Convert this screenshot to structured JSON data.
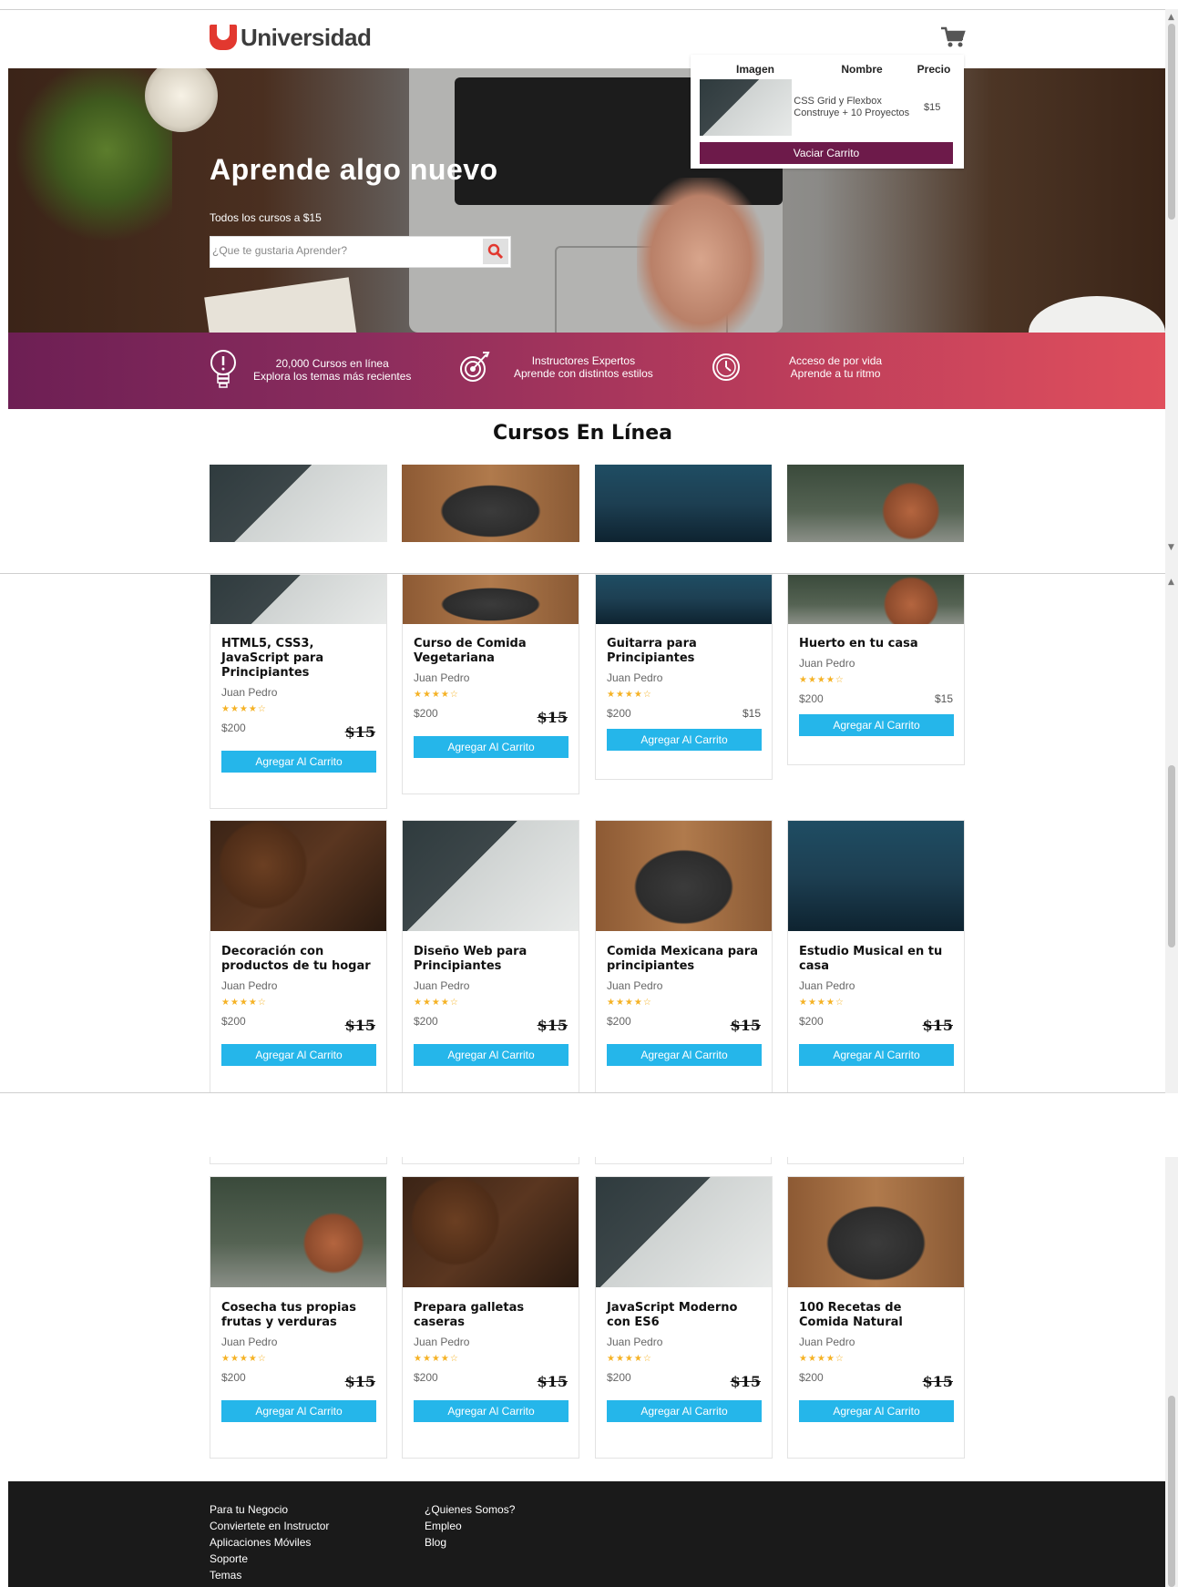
{
  "header": {
    "logo_text": "Universidad",
    "cart_icon": "shopping-cart-icon"
  },
  "hero": {
    "title": "Aprende algo nuevo",
    "subtitle": "Todos los cursos a $15",
    "search": {
      "placeholder": "¿Que te gustaria Aprender?",
      "value": "",
      "icon": "search-icon",
      "icon_color": "#e2382f"
    }
  },
  "cart": {
    "columns": [
      "Imagen",
      "Nombre",
      "Precio"
    ],
    "items": [
      {
        "name": "CSS Grid y Flexbox Construye + 10 Proyectos",
        "price": "$15"
      }
    ],
    "empty_label": "Vaciar Carrito",
    "button_color": "#6d1a4a"
  },
  "benefits": [
    {
      "icon": "lightbulb-icon",
      "line1": "20,000 Cursos en línea",
      "line2": "Explora los temas más recientes"
    },
    {
      "icon": "target-icon",
      "line1": "Instructores Expertos",
      "line2": "Aprende con distintos estilos"
    },
    {
      "icon": "clock-icon",
      "line1": "Acceso de por vida",
      "line2": "Aprende a tu ritmo"
    }
  ],
  "section_title": "Cursos En Línea",
  "courses": [
    {
      "title": "HTML5, CSS3, JavaScript para Principiantes",
      "author": "Juan Pedro",
      "stars": "★★★★☆",
      "rating": 4.5,
      "old_price": "$200",
      "price": "$15",
      "button": "Agregar Al Carrito",
      "image": "html"
    },
    {
      "title": "Curso de Comida Vegetariana",
      "author": "Juan Pedro",
      "stars": "★★★★☆",
      "rating": 4.5,
      "old_price": "$200",
      "price": "$15",
      "button": "Agregar Al Carrito",
      "image": "veg"
    },
    {
      "title": "Guitarra para Principiantes",
      "author": "Juan Pedro",
      "stars": "★★★★☆",
      "rating": 4.5,
      "old_price": "$200",
      "price": "$15",
      "button": "Agregar Al Carrito",
      "image": "guitar"
    },
    {
      "title": "Huerto en tu casa",
      "author": "Juan Pedro",
      "stars": "★★★★☆",
      "rating": 4.5,
      "old_price": "$200",
      "price": "$15",
      "button": "Agregar Al Carrito",
      "image": "garden"
    },
    {
      "title": "Decoración con productos de tu hogar",
      "author": "Juan Pedro",
      "stars": "★★★★☆",
      "rating": 4.5,
      "old_price": "$200",
      "price": "$15",
      "button": "Agregar Al Carrito",
      "image": "pine"
    },
    {
      "title": "Diseño Web para Principiantes",
      "author": "Juan Pedro",
      "stars": "★★★★☆",
      "rating": 4.5,
      "old_price": "$200",
      "price": "$15",
      "button": "Agregar Al Carrito",
      "image": "html"
    },
    {
      "title": "Comida Mexicana para principiantes",
      "author": "Juan Pedro",
      "stars": "★★★★☆",
      "rating": 4.5,
      "old_price": "$200",
      "price": "$15",
      "button": "Agregar Al Carrito",
      "image": "veg"
    },
    {
      "title": "Estudio Musical en tu casa",
      "author": "Juan Pedro",
      "stars": "★★★★☆",
      "rating": 4.5,
      "old_price": "$200",
      "price": "$15",
      "button": "Agregar Al Carrito",
      "image": "guitar"
    },
    {
      "title": "Cosecha tus propias frutas y verduras",
      "author": "Juan Pedro",
      "stars": "★★★★☆",
      "rating": 4.5,
      "old_price": "$200",
      "price": "$15",
      "button": "Agregar Al Carrito",
      "image": "garden"
    },
    {
      "title": "Prepara galletas caseras",
      "author": "Juan Pedro",
      "stars": "★★★★☆",
      "rating": 4.5,
      "old_price": "$200",
      "price": "$15",
      "button": "Agregar Al Carrito",
      "image": "pine"
    },
    {
      "title": "JavaScript Moderno con ES6",
      "author": "Juan Pedro",
      "stars": "★★★★☆",
      "rating": 4.5,
      "old_price": "$200",
      "price": "$15",
      "button": "Agregar Al Carrito",
      "image": "html"
    },
    {
      "title": "100 Recetas de Comida Natural",
      "author": "Juan Pedro",
      "stars": "★★★★☆",
      "rating": 4.5,
      "old_price": "$200",
      "price": "$15",
      "button": "Agregar Al Carrito",
      "image": "veg"
    }
  ],
  "footer": {
    "col1": [
      "Para tu Negocio",
      "Conviertete en Instructor",
      "Aplicaciones Móviles",
      "Soporte",
      "Temas"
    ],
    "col2": [
      "¿Quienes Somos?",
      "Empleo",
      "Blog"
    ]
  },
  "colors": {
    "brand": "#e2382f",
    "button": "#25b6ea",
    "benefits_start": "#6d1f54",
    "benefits_end": "#e04f5c",
    "star": "#f5b225",
    "footer_bg": "#1a1a1a"
  }
}
